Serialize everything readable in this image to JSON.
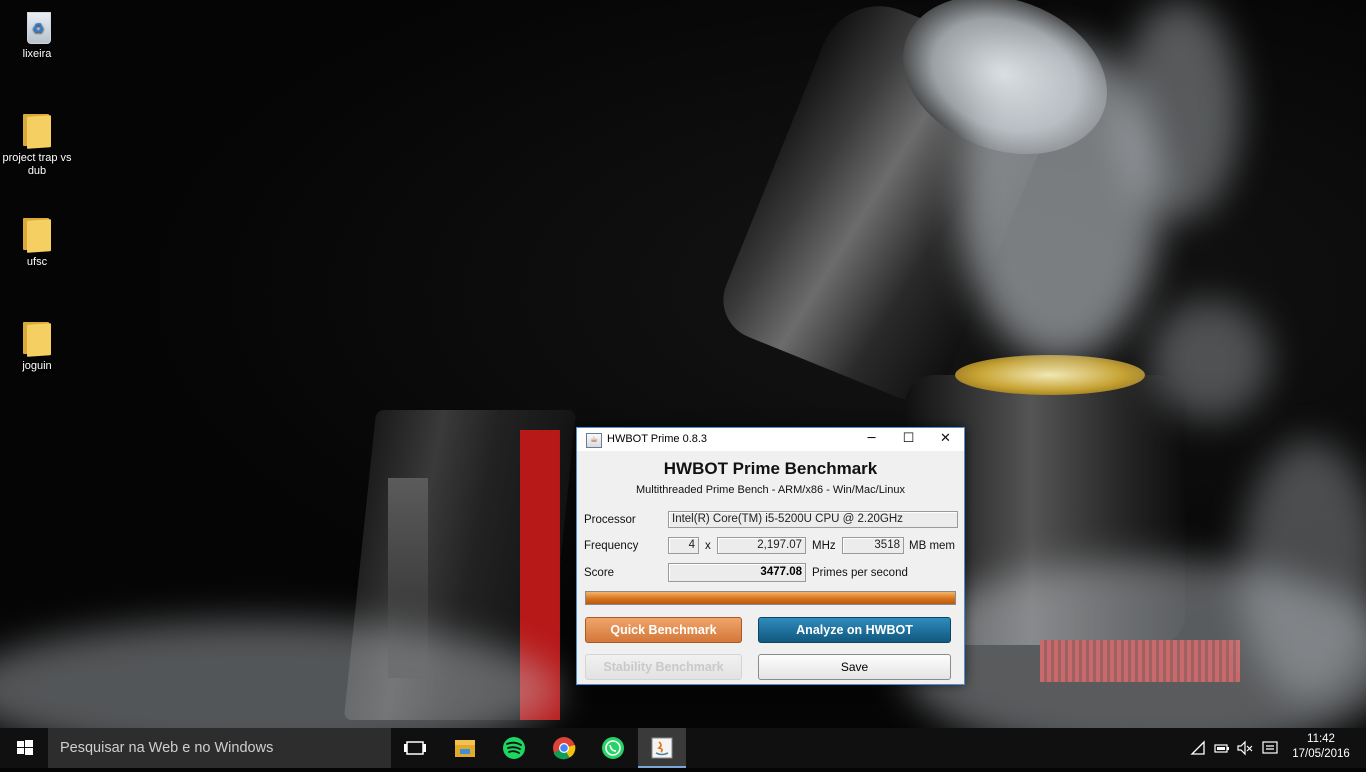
{
  "desktop": {
    "icons": [
      {
        "label": "lixeira",
        "icon": "recycle-bin-icon"
      },
      {
        "label": "project trap vs dub",
        "icon": "folder-icon"
      },
      {
        "label": "ufsc",
        "icon": "folder-icon"
      },
      {
        "label": "joguin",
        "icon": "folder-icon"
      }
    ]
  },
  "window": {
    "title": "HWBOT Prime 0.8.3",
    "controls": {
      "minimize": "─",
      "maximize": "☐",
      "close": "✕"
    },
    "heading": "HWBOT Prime Benchmark",
    "subheading": "Multithreaded Prime Bench - ARM/x86 - Win/Mac/Linux",
    "processor_label": "Processor",
    "processor_value": "Intel(R) Core(TM) i5-5200U CPU @ 2.20GHz",
    "frequency_label": "Frequency",
    "cores": "4",
    "times": "x",
    "mhz_value": "2,197.07",
    "mhz_unit": "MHz",
    "mem_value": "3518",
    "mem_unit": "MB mem",
    "score_label": "Score",
    "score_value": "3477.08",
    "score_unit": "Primes per second",
    "progress": 1.0,
    "buttons": {
      "quick": "Quick Benchmark",
      "analyze": "Analyze on HWBOT",
      "stability": "Stability Benchmark",
      "save": "Save"
    },
    "colors": {
      "accent_orange": "#d4773a",
      "accent_blue": "#11597f"
    }
  },
  "taskbar": {
    "search_placeholder": "Pesquisar na Web e no Windows",
    "apps": [
      "task-view-icon",
      "file-explorer-icon",
      "spotify-icon",
      "chrome-icon",
      "whatsapp-icon",
      "java-icon"
    ],
    "tray": [
      "wifi-icon",
      "battery-icon",
      "volume-muted-icon",
      "action-center-icon"
    ],
    "time": "11:42",
    "date": "17/05/2016"
  }
}
